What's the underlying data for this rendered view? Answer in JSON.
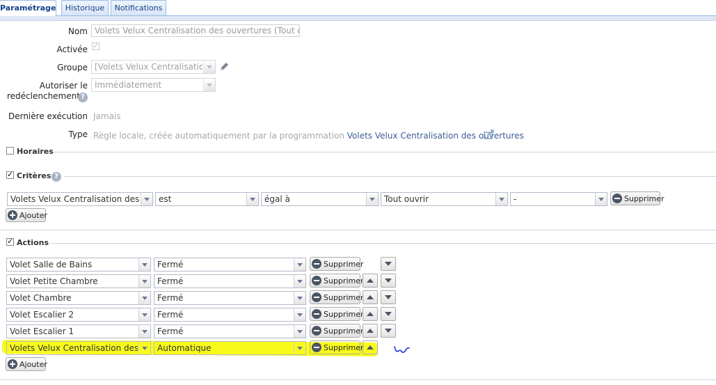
{
  "tabs": [
    "Paramétrage",
    "Historique",
    "Notifications"
  ],
  "form": {
    "nom_label": "Nom",
    "nom_value": "Volets Velux Centralisation des ouvertures (Tout ouvri",
    "activee_label": "Activée",
    "groupe_label": "Groupe",
    "groupe_value": "[Volets Velux Centralisation d",
    "autoriser_label_1": "Autoriser le",
    "autoriser_label_2": "redéclenchement",
    "autoriser_value": "Immédiatement",
    "derniere_label": "Dernière exécution",
    "derniere_value": "Jamais",
    "type_label": "Type",
    "type_text": "Règle locale, créée automatiquement par la programmation",
    "type_link": "Volets Velux Centralisation des ouvertures"
  },
  "sections": {
    "horaires": "Horaires",
    "criteres": "Critères",
    "actions": "Actions"
  },
  "criteria": {
    "field": "Volets Velux Centralisation des ou",
    "verb": "est",
    "operator": "égal à",
    "value": "Tout ouvrir",
    "extra": "-",
    "delete_label": "Supprimer",
    "add_label": "Ajouter"
  },
  "actions": {
    "rows": [
      {
        "device": "Volet Salle de Bains",
        "state": "Fermé"
      },
      {
        "device": "Volet Petite Chambre",
        "state": "Fermé"
      },
      {
        "device": "Volet Chambre",
        "state": "Fermé"
      },
      {
        "device": "Volet Escalier 2",
        "state": "Fermé"
      },
      {
        "device": "Volet Escalier 1",
        "state": "Fermé"
      },
      {
        "device": "Volets Velux Centralisation des ou",
        "state": "Automatique"
      }
    ],
    "delete_label": "Supprimer",
    "add_label": "Ajouter"
  },
  "colors": {
    "tab_border": "#99bbe8",
    "tab_text": "#15428b",
    "link": "#3b5f94",
    "highlight": "#f8fb1a",
    "annotation": "#1a2fd6"
  }
}
